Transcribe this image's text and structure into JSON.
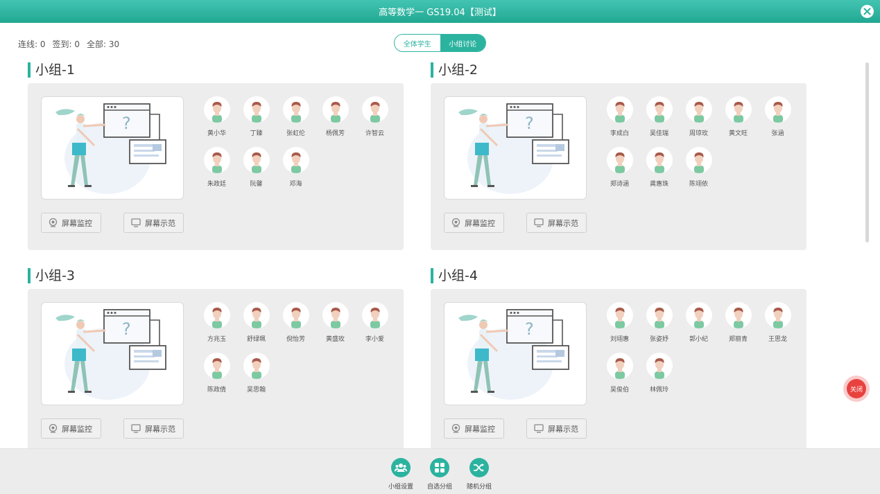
{
  "window": {
    "title": "高等数学一 GS19.04【测试】"
  },
  "stats": {
    "online": "连线: 0",
    "signed": "签到: 0",
    "total": "全部: 30"
  },
  "view_tabs": [
    {
      "label": "全体学生",
      "active": false
    },
    {
      "label": "小组讨论",
      "active": true
    }
  ],
  "accent_color": "#2bb39f",
  "groups": [
    {
      "title": "小组-1",
      "members": [
        "黄小华",
        "丁臻",
        "张虹伦",
        "杨佩芳",
        "许智云",
        "朱政廷",
        "阮馨",
        "邓海"
      ],
      "monitor_label": "屏幕监控",
      "demo_label": "屏幕示范"
    },
    {
      "title": "小组-2",
      "members": [
        "李成白",
        "吴佳瑞",
        "周琼玫",
        "黄文旺",
        "张涵",
        "郑诗涵",
        "龚惠珠",
        "陈翊依"
      ],
      "monitor_label": "屏幕监控",
      "demo_label": "屏幕示范"
    },
    {
      "title": "小组-3",
      "members": [
        "方兆玉",
        "舒绿珮",
        "倪怡芳",
        "黄盛玫",
        "李小爱",
        "陈政倩",
        "吴思翰"
      ],
      "monitor_label": "屏幕监控",
      "demo_label": "屏幕示范"
    },
    {
      "title": "小组-4",
      "members": [
        "刘翊惠",
        "张姿妤",
        "郭小纪",
        "郑丽青",
        "王思龙",
        "吴俊伯",
        "林佩玲"
      ],
      "monitor_label": "屏幕监控",
      "demo_label": "屏幕示范"
    }
  ],
  "toolbar": [
    {
      "label": "小组设置",
      "icon": "users-icon"
    },
    {
      "label": "自选分组",
      "icon": "grid-icon"
    },
    {
      "label": "随机分组",
      "icon": "shuffle-icon"
    }
  ],
  "float_close": {
    "label": "关闭",
    "color": "#e8423e"
  }
}
